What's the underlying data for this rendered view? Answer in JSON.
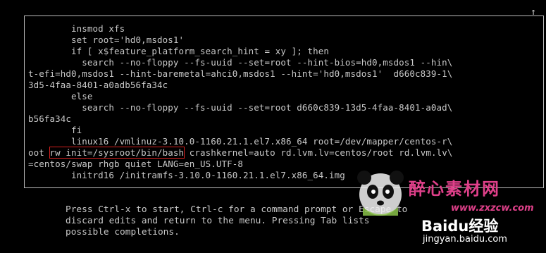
{
  "editor": {
    "scroll_indicator": "↑",
    "lines": [
      "        insmod xfs",
      "        set root='hd0,msdos1'",
      "        if [ x$feature_platform_search_hint = xy ]; then",
      "          search --no-floppy --fs-uuid --set=root --hint-bios=hd0,msdos1 --hin\\",
      "t-efi=hd0,msdos1 --hint-baremetal=ahci0,msdos1 --hint='hd0,msdos1'  d660c839-1\\",
      "3d5-4faa-8401-a0adb56fa34c",
      "        else",
      "          search --no-floppy --fs-uuid --set=root d660c839-13d5-4faa-8401-a0ad\\",
      "b56fa34c",
      "        fi",
      "        linux16 /vmlinuz-3.10.0-1160.21.1.el7.x86_64 root=/dev/mapper/centos-r\\"
    ],
    "line_oot_prefix": "oot ",
    "line_oot_highlight": "rw init=/sysroot/bin/bash",
    "line_oot_suffix": " crashkernel=auto rd.lvm.lv=centos/root rd.lvm.lv\\",
    "line_swap": "=centos/swap rhgb quiet LANG=en_US.UTF-8",
    "line_initrd": "        initrd16 /initramfs-3.10.0-1160.21.1.el7.x86_64.img"
  },
  "help": {
    "line1": "Press Ctrl-x to start, Ctrl-c for a command prompt or Escape to",
    "line2": "discard edits and return to the menu. Pressing Tab lists",
    "line3": "possible completions."
  },
  "watermark": {
    "cn_text": "醉心素材网",
    "url": "www.zxzcw.com",
    "baidu_text": "Baidu经验",
    "baidu_url": "jingyan.baidu.com"
  }
}
